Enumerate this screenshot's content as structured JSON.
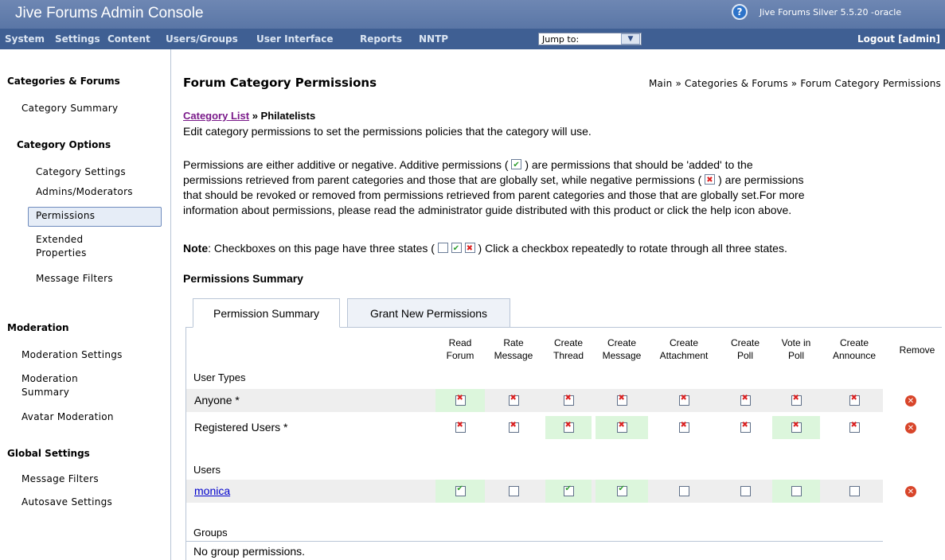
{
  "header": {
    "title": "Jive Forums Admin Console",
    "help_icon": "help-icon",
    "version": "Jive Forums Silver 5.5.20 -oracle"
  },
  "nav": {
    "items": [
      "System",
      "Settings",
      "Content",
      "Users/Groups",
      "User Interface",
      "Reports",
      "NNTP"
    ],
    "jump_label": "Jump to:",
    "logout": "Logout [admin]"
  },
  "sidebar": {
    "sections": [
      {
        "heading": "Categories & Forums",
        "items": [
          "Category Summary"
        ]
      },
      {
        "heading": "Category Options",
        "items": [
          "Category Settings",
          "Admins/Moderators",
          "Permissions",
          "Extended Properties",
          "Message Filters"
        ]
      },
      {
        "heading": "Moderation",
        "items": [
          "Moderation Settings",
          "Moderation Summary",
          "Avatar Moderation"
        ]
      },
      {
        "heading": "Global Settings",
        "items": [
          "Message Filters",
          "Autosave Settings"
        ]
      }
    ],
    "active_item": "Permissions"
  },
  "main": {
    "title": "Forum Category Permissions",
    "breadcrumb": "Main » Categories & Forums » Forum Category Permissions",
    "category_link": "Category List",
    "category_sep": " » ",
    "category_name": "Philatelists",
    "intro": "Edit category permissions to set the permissions policies that the category will use.",
    "para_1": "Permissions are either additive or negative. Additive permissions (",
    "para_2": ") are permissions that should be 'added' to the",
    "para_3": "permissions retrieved from parent categories and those that are globally set, while negative permissions (",
    "para_4": ") are permissions",
    "para_5": "that should be revoked or removed from permissions retrieved from parent categories and those that are globally set.For more",
    "para_6": "information about permissions, please read the administrator guide distributed with this product or click the help icon above.",
    "note_label": "Note",
    "note_1": ": Checkboxes on this page have three states (",
    "note_2": ") Click a checkbox repeatedly to rotate through all three states.",
    "section_title": "Permissions Summary",
    "tabs": [
      "Permission Summary",
      "Grant New Permissions"
    ],
    "columns": [
      "Read Forum",
      "Rate Message",
      "Create Thread",
      "Create Message",
      "Create Attachment",
      "Create Poll",
      "Vote in Poll",
      "Create Announce"
    ],
    "remove_header": "Remove",
    "user_types_label": "User Types",
    "users_label": "Users",
    "groups_label": "Groups",
    "no_groups": "No group permissions.",
    "rows": [
      {
        "name": "Anyone *",
        "states": [
          "x",
          "x",
          "x",
          "x",
          "x",
          "x",
          "x",
          "x"
        ],
        "highlight": [
          true,
          false,
          false,
          false,
          false,
          false,
          false,
          false
        ]
      },
      {
        "name": "Registered Users *",
        "states": [
          "x",
          "x",
          "x",
          "x",
          "x",
          "x",
          "x",
          "x"
        ],
        "highlight": [
          false,
          false,
          true,
          true,
          false,
          false,
          true,
          false
        ]
      },
      {
        "name": "monica",
        "states": [
          "check",
          "empty",
          "check",
          "check",
          "empty",
          "empty",
          "empty",
          "empty"
        ],
        "highlight": [
          true,
          false,
          true,
          true,
          false,
          false,
          true,
          false
        ]
      }
    ]
  },
  "colors": {
    "header": "#5a76a6",
    "nav": "#3f5f93",
    "allowed_bg": "#dcf6dc",
    "row_bg": "#eeeeee",
    "link": "#0000cc"
  }
}
